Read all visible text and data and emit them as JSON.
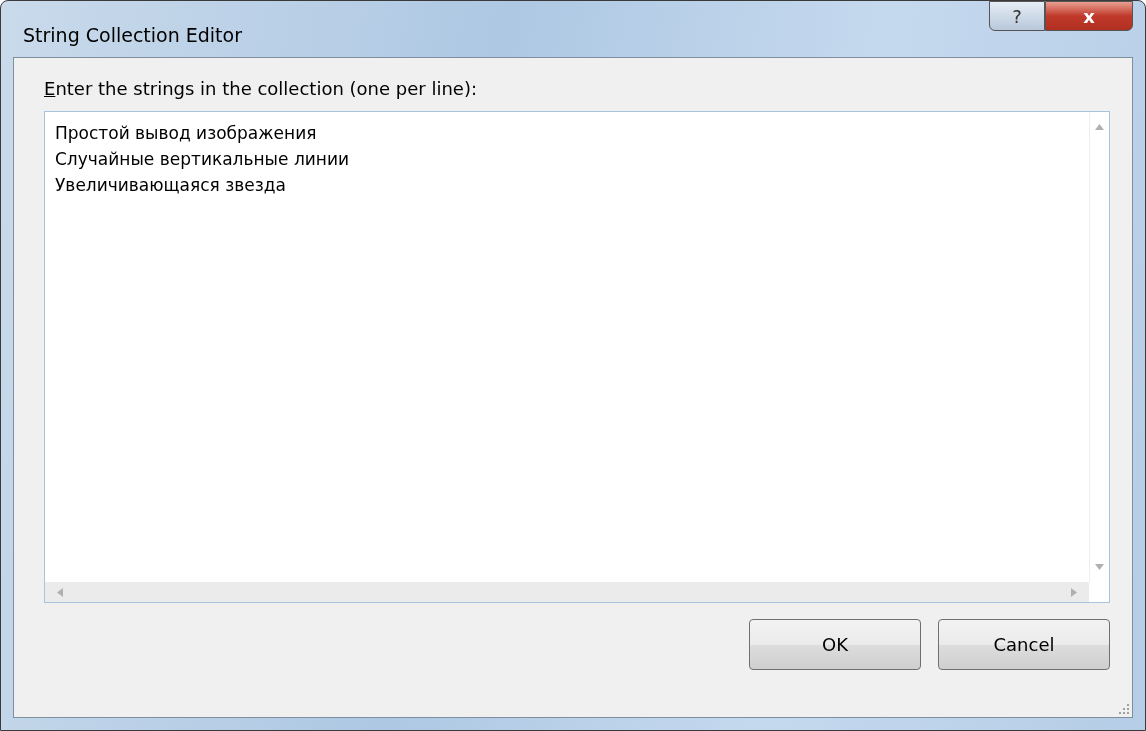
{
  "window": {
    "title": "String Collection Editor",
    "help_button": "?",
    "close_button": "x"
  },
  "prompt": {
    "label": "Enter the strings in the collection (one per line):",
    "accelerator_underlined": true
  },
  "lines": [
    "Простой вывод изображения",
    "Случайные вертикальные линии",
    "Увеличивающаяся звезда"
  ],
  "buttons": [
    "OK",
    "Cancel"
  ]
}
